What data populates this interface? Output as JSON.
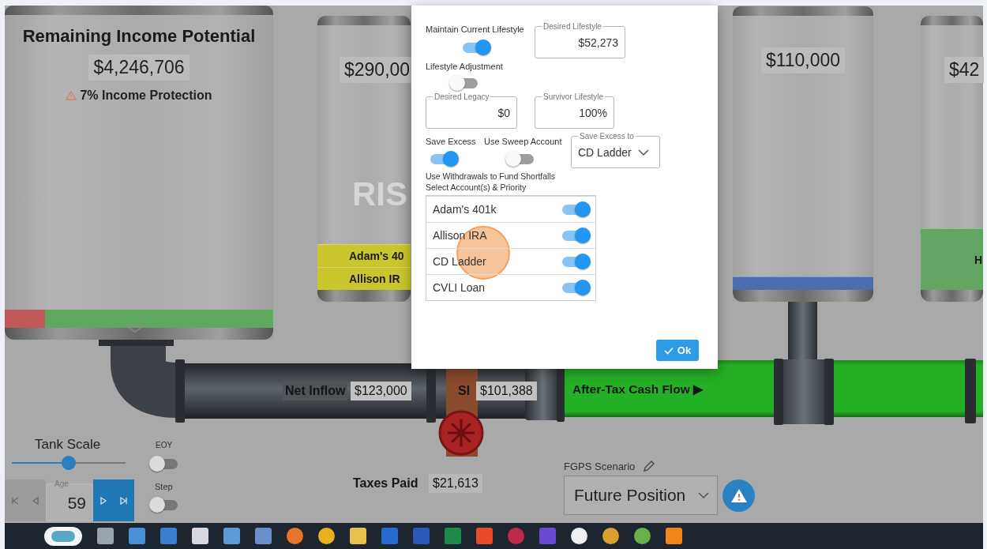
{
  "tanks": [
    {
      "title": "Remaining Income Potential",
      "value": "$4,246,706",
      "warning": "7% Income Protection",
      "meter": {
        "level": 0.85
      }
    },
    {
      "value": "$290,00",
      "faint_label": "RIS",
      "bands": [
        {
          "label": "Adam's 40",
          "color": "#c8c62c"
        },
        {
          "label": "Allison IR",
          "color": "#c8c62c"
        }
      ]
    },
    {
      "value": "$110,000",
      "bands": [
        {
          "color": "#4a6db0"
        }
      ]
    },
    {
      "value": "$42",
      "bands": [
        {
          "label": "H",
          "color": "#62a462"
        }
      ]
    }
  ],
  "flows": {
    "net_inflow_label": "Net Inflow",
    "net_inflow": "$123,000",
    "si_label": "SI",
    "si": "$101,388",
    "cash_flow_label": "After-Tax Cash Flow ▶"
  },
  "taxes": {
    "label": "Taxes Paid",
    "value": "$21,613"
  },
  "tank_scale": {
    "label": "Tank Scale",
    "level": 0.5
  },
  "eoy": {
    "label": "EOY",
    "on": false
  },
  "step": {
    "label": "Step",
    "on": false
  },
  "age": {
    "label": "Age",
    "value": "59"
  },
  "scenario": {
    "label": "FGPS Scenario",
    "value": "Future Position"
  },
  "dialog": {
    "maintain_current_lifestyle": {
      "label": "Maintain Current Lifestyle",
      "on": true
    },
    "desired_lifestyle": {
      "label": "Desired Lifestyle",
      "value": "$52,273"
    },
    "lifestyle_adjustment": {
      "label": "Lifestyle Adjustment",
      "on": false
    },
    "desired_legacy": {
      "label": "Desired Legacy",
      "value": "$0"
    },
    "survivor_lifestyle": {
      "label": "Survivor Lifestyle",
      "value": "100%"
    },
    "save_excess": {
      "label": "Save Excess",
      "on": true
    },
    "use_sweep_account": {
      "label": "Use Sweep Account",
      "on": false
    },
    "save_excess_to": {
      "label": "Save Excess to",
      "value": "CD Ladder"
    },
    "withdrawals_heading": "Use Withdrawals to Fund Shortfalls",
    "accounts_heading": "Select Account(s) & Priority",
    "accounts": [
      {
        "name": "Adam's 401k",
        "on": true
      },
      {
        "name": "Allison IRA",
        "on": true
      },
      {
        "name": "CD Ladder",
        "on": true
      },
      {
        "name": "CVLI Loan",
        "on": true
      }
    ],
    "ok_button": "Ok"
  }
}
